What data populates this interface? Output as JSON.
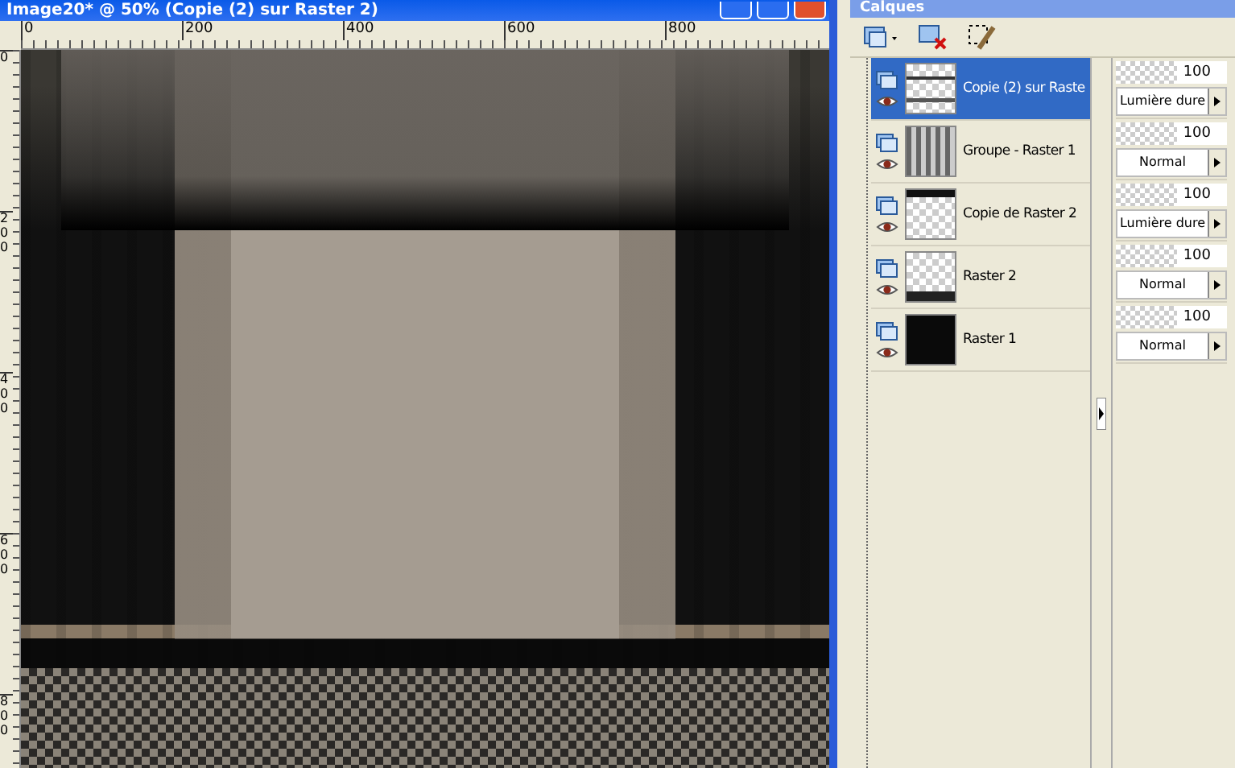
{
  "window": {
    "title": "Image20* @ 50% (Copie (2) sur Raster 2)"
  },
  "ruler": {
    "horizontal": [
      "0",
      "200",
      "400",
      "600",
      "800"
    ],
    "vertical": [
      "0",
      "200",
      "400",
      "600",
      "800"
    ]
  },
  "layers_panel": {
    "title": "Calques",
    "layers": [
      {
        "name": "Copie (2) sur Raste",
        "selected": true,
        "kind": "strokes",
        "opacity": "100",
        "blend": "Lumière dure"
      },
      {
        "name": "Groupe - Raster 1",
        "selected": false,
        "kind": "curtain",
        "opacity": "100",
        "blend": "Normal"
      },
      {
        "name": "Copie de Raster 2",
        "selected": false,
        "kind": "topbar",
        "opacity": "100",
        "blend": "Lumière dure"
      },
      {
        "name": "Raster 2",
        "selected": false,
        "kind": "bottombar",
        "opacity": "100",
        "blend": "Normal"
      },
      {
        "name": "Raster 1",
        "selected": false,
        "kind": "black",
        "opacity": "100",
        "blend": "Normal"
      }
    ]
  }
}
